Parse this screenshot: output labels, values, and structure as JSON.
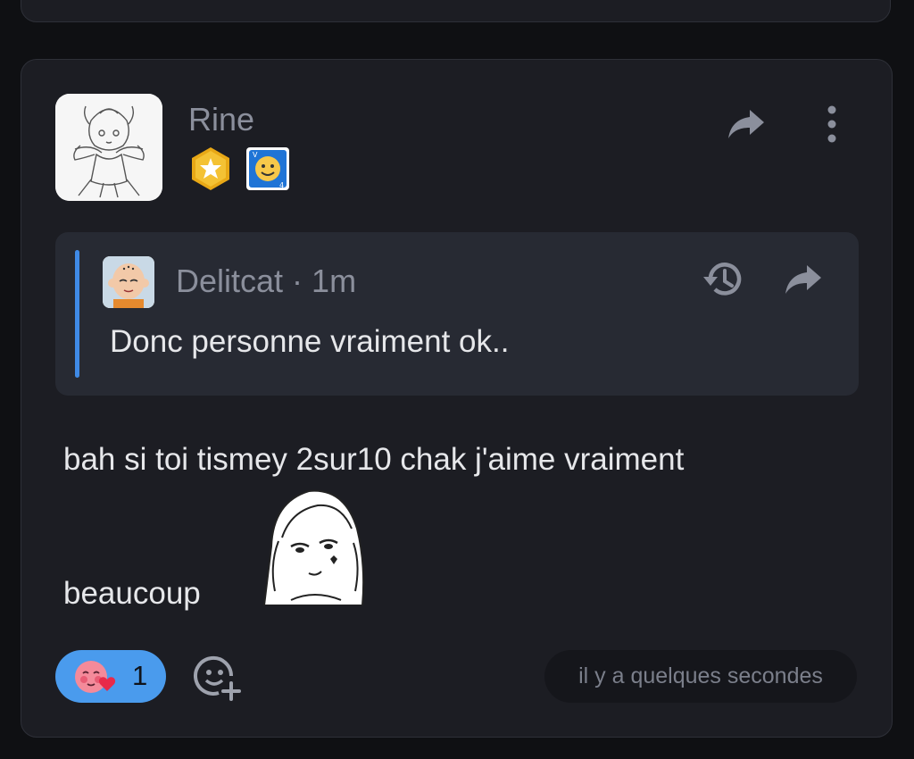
{
  "post": {
    "author": "Rine",
    "badges": [
      "star-badge",
      "smiley-card-badge"
    ],
    "quote": {
      "author": "Delitcat",
      "separator": "·",
      "age": "1m",
      "text": "Donc personne vraiment ok.."
    },
    "body_line1": "bah si toi tismey 2sur10 chak j'aime vraiment",
    "body_line2": "beaucoup",
    "reaction": {
      "emoji": "blushing-heart-face",
      "count": "1"
    },
    "timestamp": "il y a quelques secondes"
  },
  "colors": {
    "background": "#0f1013",
    "card": "#1c1d23",
    "quote_background": "#272a33",
    "quote_bar": "#3f8ae6",
    "reaction_pill": "#4a9bed",
    "muted_text": "#8b8f9c",
    "text": "#e6e7ea"
  }
}
